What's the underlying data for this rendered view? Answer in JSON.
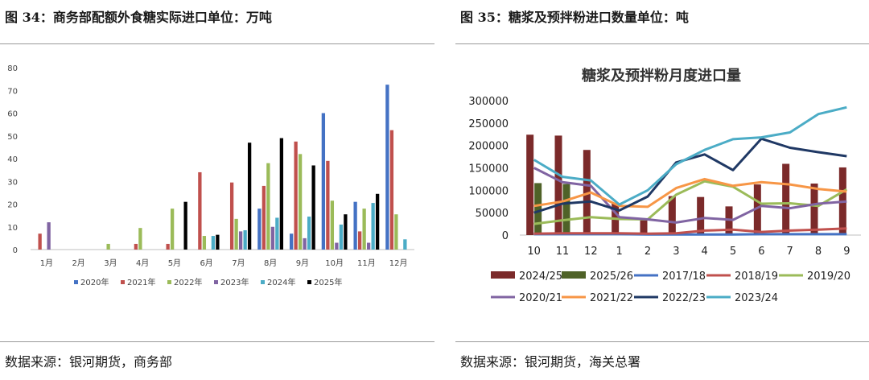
{
  "left": {
    "figure_title": "图 34：商务部配额外食糖实际进口单位：万吨",
    "source": "数据来源：银河期货，商务部",
    "chart_data": {
      "type": "bar",
      "title": "",
      "categories": [
        "1月",
        "2月",
        "3月",
        "4月",
        "5月",
        "6月",
        "7月",
        "8月",
        "9月",
        "10月",
        "11月",
        "12月"
      ],
      "ylim": [
        0,
        80
      ],
      "yticks": [
        0,
        10,
        20,
        30,
        40,
        50,
        60,
        70,
        80
      ],
      "grid": false,
      "legend_position": "bottom",
      "series": [
        {
          "name": "2020年",
          "color": "#4472C4",
          "values": [
            0,
            0,
            0,
            0,
            0,
            0,
            0,
            18,
            7,
            60,
            21,
            72.5
          ]
        },
        {
          "name": "2021年",
          "color": "#C0504D",
          "values": [
            7,
            0,
            0,
            2.5,
            2.5,
            34,
            29.5,
            28,
            47.5,
            39,
            8,
            52.5
          ]
        },
        {
          "name": "2022年",
          "color": "#9BBB59",
          "values": [
            0,
            0,
            2.5,
            9.5,
            18,
            6,
            13.5,
            38,
            42,
            21.5,
            18,
            15.5
          ]
        },
        {
          "name": "2023年",
          "color": "#8064A2",
          "values": [
            12,
            0,
            0,
            0,
            0,
            0,
            8,
            10,
            5,
            3,
            3,
            0
          ]
        },
        {
          "name": "2024年",
          "color": "#4BACC6",
          "values": [
            0,
            0,
            0,
            0,
            0,
            6,
            8.5,
            14,
            14.5,
            11,
            20.5,
            4.5
          ]
        },
        {
          "name": "2025年",
          "color": "#000000",
          "values": [
            0,
            0,
            0,
            0,
            21,
            6.5,
            47,
            49,
            37,
            15.5,
            24.5,
            0
          ]
        }
      ]
    }
  },
  "right": {
    "figure_title": "图 35：糖浆及预拌粉进口数量单位：吨",
    "source": "数据来源：银河期货，海关总署",
    "chart_data": {
      "type": "bar+line",
      "title": "糖浆及预拌粉月度进口量",
      "categories": [
        "10",
        "11",
        "12",
        "1",
        "2",
        "3",
        "4",
        "5",
        "6",
        "7",
        "8",
        "9"
      ],
      "ylim": [
        0,
        300000
      ],
      "yticks": [
        0,
        50000,
        100000,
        150000,
        200000,
        250000,
        300000
      ],
      "grid": false,
      "legend_position": "bottom",
      "bar_series": [
        {
          "name": "2024/25",
          "color": "#7B2A2A",
          "values": [
            224000,
            222000,
            190000,
            70000,
            36000,
            87000,
            85000,
            64000,
            113000,
            159000,
            115000,
            151000
          ]
        },
        {
          "name": "2025/26",
          "color": "#4F6228",
          "values": [
            116000,
            114000,
            null,
            null,
            null,
            null,
            null,
            null,
            null,
            null,
            null,
            null
          ]
        }
      ],
      "line_series": [
        {
          "name": "2017/18",
          "color": "#4472C4",
          "values": [
            2000,
            2000,
            2000,
            2000,
            1500,
            1500,
            1500,
            1500,
            2000,
            2000,
            2000,
            2000
          ]
        },
        {
          "name": "2018/19",
          "color": "#C0504D",
          "values": [
            3000,
            4000,
            4000,
            4000,
            3000,
            4000,
            10000,
            12000,
            7000,
            10000,
            12000,
            15000
          ]
        },
        {
          "name": "2019/20",
          "color": "#9BBB59",
          "values": [
            25000,
            33000,
            40000,
            36000,
            35000,
            90000,
            120000,
            108000,
            70000,
            71000,
            65000,
            102000
          ]
        },
        {
          "name": "2020/21",
          "color": "#8064A2",
          "values": [
            150000,
            118000,
            110000,
            40000,
            35000,
            28000,
            38000,
            34000,
            65000,
            60000,
            70000,
            75000
          ]
        },
        {
          "name": "2021/22",
          "color": "#F79646",
          "values": [
            65000,
            75000,
            95000,
            65000,
            63000,
            105000,
            125000,
            110000,
            118000,
            113000,
            103000,
            97000
          ]
        },
        {
          "name": "2022/23",
          "color": "#1F3864",
          "values": [
            50000,
            70000,
            75000,
            55000,
            86000,
            162000,
            180000,
            145000,
            215000,
            195000,
            185000,
            176000
          ]
        },
        {
          "name": "2023/24",
          "color": "#4BACC6",
          "values": [
            168000,
            130000,
            122000,
            68000,
            100000,
            158000,
            190000,
            214000,
            218000,
            229000,
            270000,
            285000
          ]
        }
      ]
    }
  }
}
